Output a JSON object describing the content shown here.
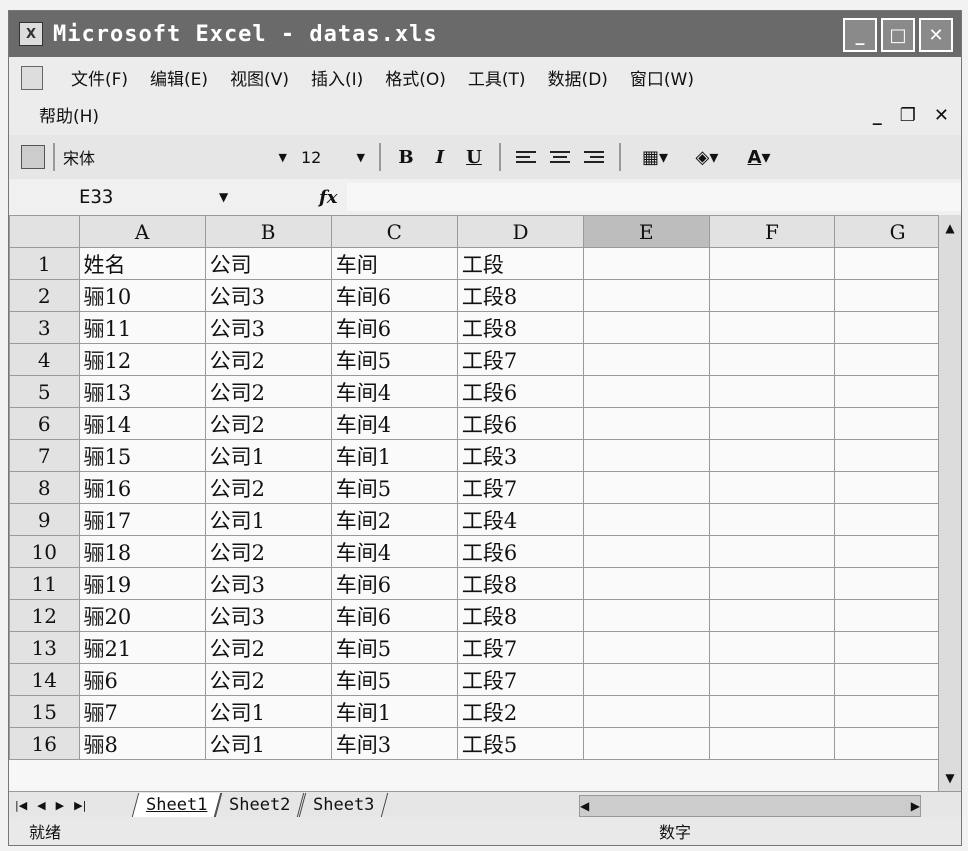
{
  "window": {
    "title": "Microsoft Excel - datas.xls",
    "title_icon": "excel-icon"
  },
  "menu": {
    "items": [
      "文件(F)",
      "编辑(E)",
      "视图(V)",
      "插入(I)",
      "格式(O)",
      "工具(T)",
      "数据(D)",
      "窗口(W)"
    ],
    "help": "帮助(H)"
  },
  "toolbar": {
    "font_name": "宋体",
    "font_size": "12",
    "bold": "B",
    "italic": "I",
    "underline": "U",
    "font_color_label": "A"
  },
  "formula_bar": {
    "name_box": "E33",
    "fx_label": "fx",
    "formula": ""
  },
  "grid": {
    "selected_column": "E",
    "columns": [
      "A",
      "B",
      "C",
      "D",
      "E",
      "F",
      "G"
    ],
    "rows": [
      {
        "num": "1",
        "cells": [
          "姓名",
          "公司",
          "车间",
          "工段"
        ]
      },
      {
        "num": "2",
        "cells": [
          "骊10",
          "公司3",
          "车间6",
          "工段8"
        ]
      },
      {
        "num": "3",
        "cells": [
          "骊11",
          "公司3",
          "车间6",
          "工段8"
        ]
      },
      {
        "num": "4",
        "cells": [
          "骊12",
          "公司2",
          "车间5",
          "工段7"
        ]
      },
      {
        "num": "5",
        "cells": [
          "骊13",
          "公司2",
          "车间4",
          "工段6"
        ]
      },
      {
        "num": "6",
        "cells": [
          "骊14",
          "公司2",
          "车间4",
          "工段6"
        ]
      },
      {
        "num": "7",
        "cells": [
          "骊15",
          "公司1",
          "车间1",
          "工段3"
        ]
      },
      {
        "num": "8",
        "cells": [
          "骊16",
          "公司2",
          "车间5",
          "工段7"
        ]
      },
      {
        "num": "9",
        "cells": [
          "骊17",
          "公司1",
          "车间2",
          "工段4"
        ]
      },
      {
        "num": "10",
        "cells": [
          "骊18",
          "公司2",
          "车间4",
          "工段6"
        ]
      },
      {
        "num": "11",
        "cells": [
          "骊19",
          "公司3",
          "车间6",
          "工段8"
        ]
      },
      {
        "num": "12",
        "cells": [
          "骊20",
          "公司3",
          "车间6",
          "工段8"
        ]
      },
      {
        "num": "13",
        "cells": [
          "骊21",
          "公司2",
          "车间5",
          "工段7"
        ]
      },
      {
        "num": "14",
        "cells": [
          "骊6",
          "公司2",
          "车间5",
          "工段7"
        ]
      },
      {
        "num": "15",
        "cells": [
          "骊7",
          "公司1",
          "车间1",
          "工段2"
        ]
      },
      {
        "num": "16",
        "cells": [
          "骊8",
          "公司1",
          "车间3",
          "工段5"
        ]
      }
    ]
  },
  "sheets": [
    "Sheet1",
    "Sheet2",
    "Sheet3"
  ],
  "active_sheet": "Sheet1",
  "status": {
    "ready": "就绪",
    "mode": "数字"
  }
}
